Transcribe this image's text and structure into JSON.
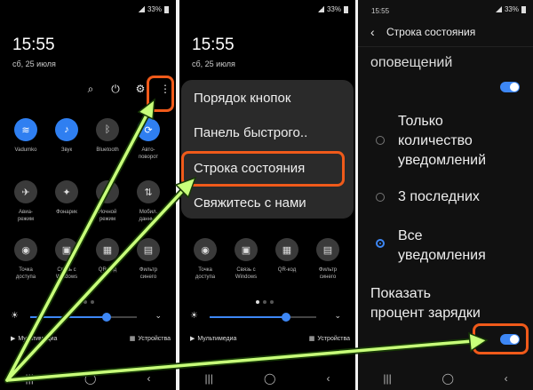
{
  "panel1": {
    "status": "33%",
    "time": "15:55",
    "date": "сб, 25 июля",
    "tiles": [
      {
        "label": "Vadumko",
        "icon": "wifi-icon",
        "glyph": "≋",
        "on": true
      },
      {
        "label": "Звук",
        "icon": "speaker-icon",
        "glyph": "♪",
        "on": true
      },
      {
        "label": "Bluetooth",
        "icon": "bluetooth-icon",
        "glyph": "ᛒ",
        "on": false
      },
      {
        "label": "Авто-\nповорот",
        "icon": "auto-rotate-icon",
        "glyph": "⟳",
        "on": true
      },
      {
        "label": "Авиа-\nрежим",
        "icon": "airplane-icon",
        "glyph": "✈",
        "on": false
      },
      {
        "label": "Фонарик",
        "icon": "flashlight-icon",
        "glyph": "✦",
        "on": false
      },
      {
        "label": "Ночной\nрежим",
        "icon": "night-mode-icon",
        "glyph": "☾",
        "on": false
      },
      {
        "label": "Мобил.\nданные",
        "icon": "mobile-data-icon",
        "glyph": "⇅",
        "on": false
      }
    ],
    "tiles2": [
      {
        "label": "Точка\nдоступа",
        "icon": "hotspot-icon",
        "glyph": "◉",
        "on": false
      },
      {
        "label": "Связь с\nWindows",
        "icon": "windows-link-icon",
        "glyph": "▣",
        "on": false
      },
      {
        "label": "QR-код",
        "icon": "qr-code-icon",
        "glyph": "▦",
        "on": false
      },
      {
        "label": "Фильтр\nсинего",
        "icon": "blue-filter-icon",
        "glyph": "▤",
        "on": false
      }
    ],
    "media": "Мультимедиа",
    "devices": "Устройства",
    "brightness": 0.72
  },
  "panel2": {
    "status": "33%",
    "time": "15:55",
    "date": "сб, 25 июля",
    "tiles2": [
      {
        "label": "Точка\nдоступа",
        "icon": "hotspot-icon",
        "glyph": "◉"
      },
      {
        "label": "Связь с\nWindows",
        "icon": "windows-link-icon",
        "glyph": "▣"
      },
      {
        "label": "QR-код",
        "icon": "qr-code-icon",
        "glyph": "▦"
      },
      {
        "label": "Фильтр\nсинего",
        "icon": "blue-filter-icon",
        "glyph": "▤"
      }
    ],
    "menu": [
      "Порядок кнопок",
      "Панель быстрого..",
      "Строка состояния",
      "Свяжитесь с нами"
    ],
    "media": "Мультимедиа",
    "devices": "Устройства",
    "brightness": 0.72
  },
  "panel3": {
    "status_time": "15:55",
    "status": "33%",
    "title": "Строка состояния",
    "subheading": "оповещений",
    "options": [
      "Только\nколичество\nуведомлений",
      "3 последних",
      "Все\nуведомления"
    ],
    "selected": 2,
    "percent_label": "Показать\nпроцент зарядки"
  },
  "colors": {
    "accent": "#3d87f5",
    "highlight": "#f05a1a",
    "arrow": "#b6ff6a"
  }
}
